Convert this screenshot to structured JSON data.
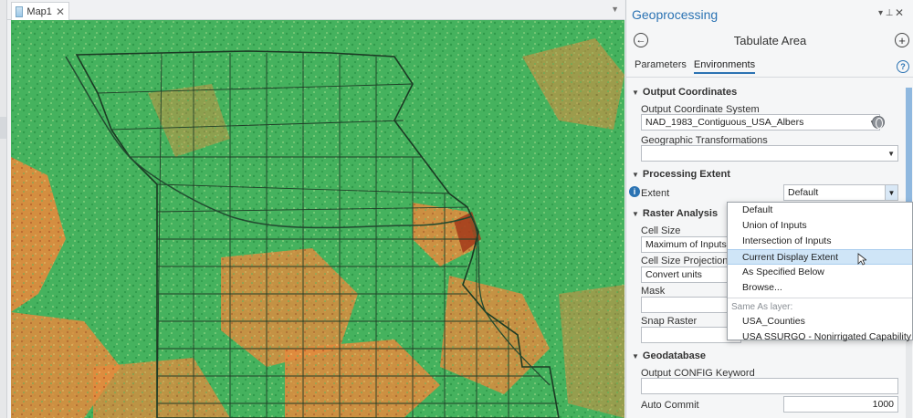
{
  "map": {
    "tab_label": "Map1",
    "tab_close": "✕",
    "overflow_glyph": "▼"
  },
  "gp": {
    "pane_title": "Geoprocessing",
    "pin_glyph": "▾ ⊥",
    "close_glyph": "✕",
    "tool_title": "Tabulate Area",
    "back_glyph": "←",
    "add_glyph": "+",
    "help_glyph": "?",
    "tabs": {
      "parameters": "Parameters",
      "environments": "Environments"
    },
    "sections": {
      "output_coordinates": {
        "title": "Output Coordinates",
        "output_cs_label": "Output Coordinate System",
        "output_cs_value": "NAD_1983_Contiguous_USA_Albers",
        "geo_transform_label": "Geographic Transformations",
        "geo_transform_value": ""
      },
      "processing_extent": {
        "title": "Processing Extent",
        "extent_label": "Extent",
        "extent_value": "Default"
      },
      "raster_analysis": {
        "title": "Raster Analysis",
        "cell_size_label": "Cell Size",
        "cell_size_value": "Maximum of Inputs",
        "cell_size_proj_label": "Cell Size Projection Me",
        "cell_size_proj_value": "Convert units",
        "mask_label": "Mask",
        "mask_value": "",
        "snap_raster_label": "Snap Raster",
        "snap_raster_value": ""
      },
      "geodatabase": {
        "title": "Geodatabase",
        "config_keyword_label": "Output CONFIG Keyword",
        "config_keyword_value": "",
        "auto_commit_label": "Auto Commit",
        "auto_commit_value": "1000"
      }
    },
    "info_glyph": "i",
    "chevron_glyph": "▼"
  },
  "extent_dropdown": {
    "items": [
      "Default",
      "Union of Inputs",
      "Intersection of Inputs",
      "Current Display Extent",
      "As Specified Below",
      "Browse..."
    ],
    "selected": "Current Display Extent",
    "group_header": "Same As layer:",
    "layers": [
      "USA_Counties",
      "USA SSURGO - Nonirrigated Capability Class"
    ]
  },
  "colors": {
    "accent": "#2b73b3",
    "map_green": "#3fae5a",
    "map_orange": "#e0873a",
    "selection": "#cfe5f7"
  }
}
